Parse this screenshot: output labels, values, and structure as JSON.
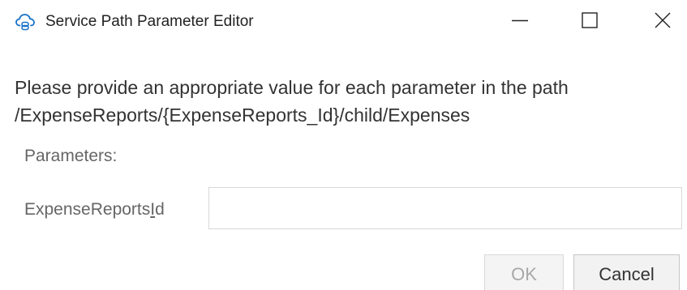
{
  "window": {
    "title": "Service Path Parameter Editor",
    "icon": "cloud-link-icon",
    "controls": {
      "minimize_icon": "minimize-icon",
      "maximize_icon": "maximize-icon",
      "close_icon": "close-icon"
    }
  },
  "content": {
    "instruction": "Please provide an appropriate value for each parameter in the path",
    "path": "/ExpenseReports/{ExpenseReports_Id}/child/Expenses",
    "parameters_label": "Parameters:",
    "parameter": {
      "label_prefix": "ExpenseReports",
      "label_accel": "I",
      "label_suffix": "d",
      "value": "",
      "placeholder": ""
    }
  },
  "buttons": {
    "ok_label": "OK",
    "ok_enabled": false,
    "cancel_label": "Cancel"
  },
  "colors": {
    "icon_blue": "#1a73c8",
    "text": "#333333",
    "muted_text": "#666666",
    "disabled_text": "#a8a8a8"
  }
}
